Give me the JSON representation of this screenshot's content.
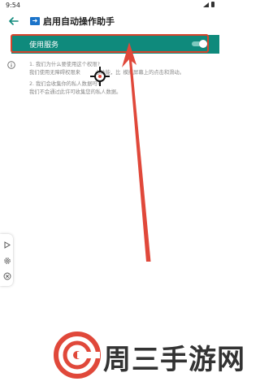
{
  "status_bar": {
    "time": "9:54"
  },
  "app_bar": {
    "title": "启用自动操作助手"
  },
  "service": {
    "label": "使用服务",
    "enabled": true
  },
  "faq": {
    "q1": "1. 我们为什么要使用这个权限?",
    "a1_part1": "我们使用无障碍权限来",
    "a1_part2": "心功能，比",
    "a1_part3": "模拟屏幕上的点击和滑动。",
    "q2": "2. 我们会收集你的私人数据吗?",
    "a2": "我们不会通过此许可收集您的私人数据。"
  },
  "watermark": {
    "text": "周三手游网"
  },
  "colors": {
    "accent": "#0f8a7c",
    "highlight": "#d8432b",
    "arrow": "#e0483a",
    "title_icon": "#1a73c9"
  }
}
